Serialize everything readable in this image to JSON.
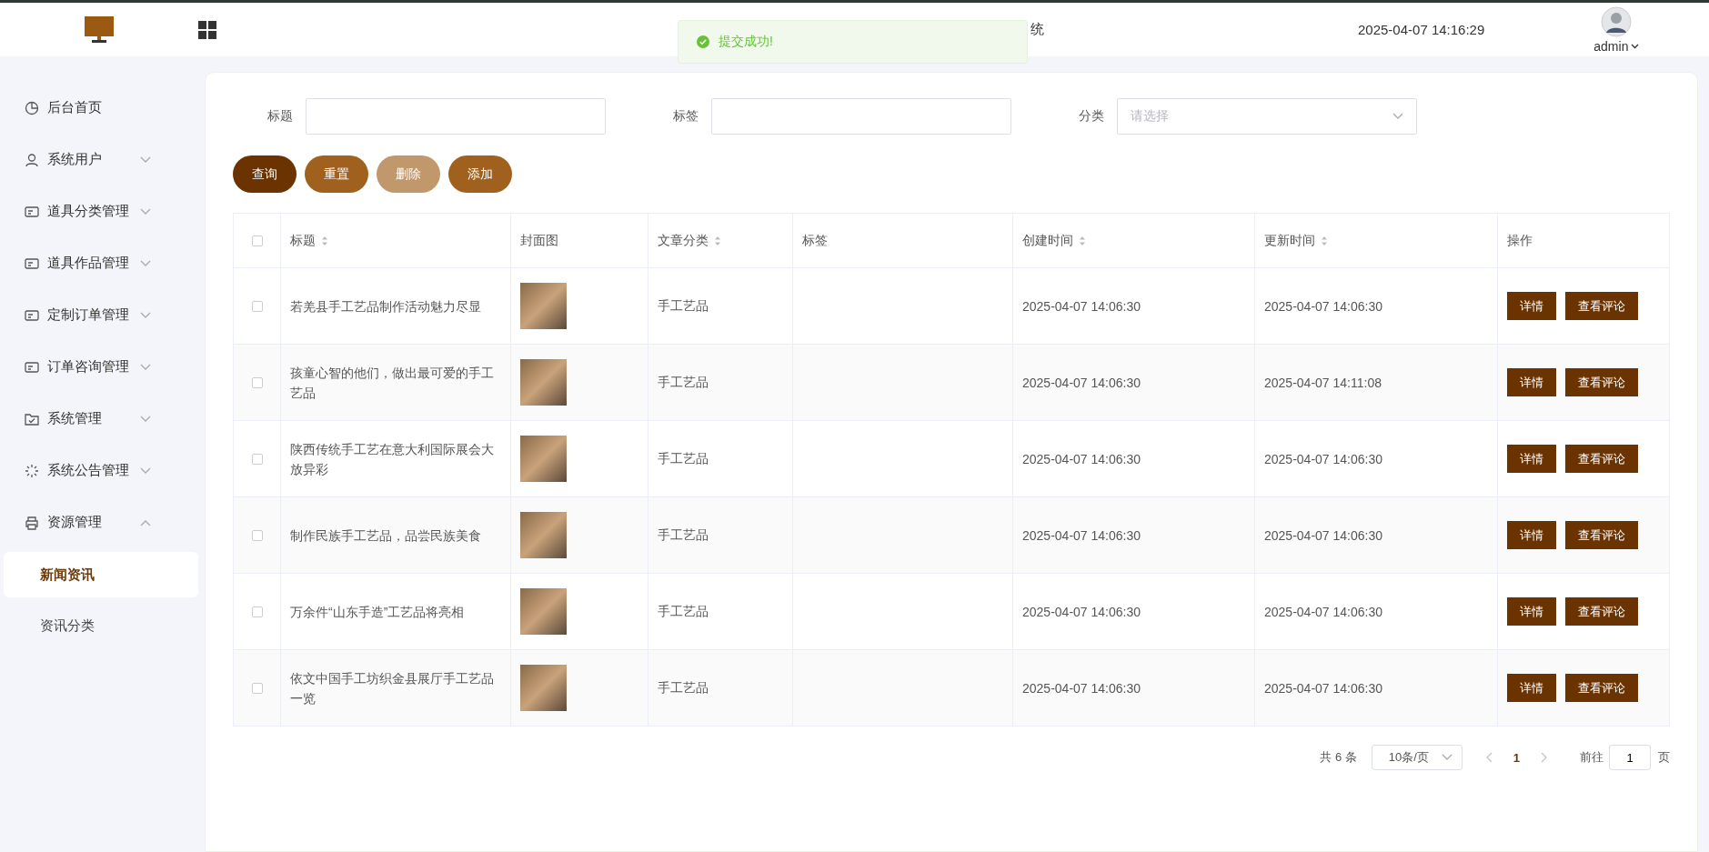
{
  "header": {
    "title": "统",
    "datetime": "2025-04-07 14:16:29",
    "user": "admin"
  },
  "toast": {
    "message": "提交成功!"
  },
  "sidebar": {
    "items": [
      {
        "label": "后台首页"
      },
      {
        "label": "系统用户",
        "expanded": false
      },
      {
        "label": "道具分类管理",
        "expanded": false
      },
      {
        "label": "道具作品管理",
        "expanded": false
      },
      {
        "label": "定制订单管理",
        "expanded": false
      },
      {
        "label": "订单咨询管理",
        "expanded": false
      },
      {
        "label": "系统管理",
        "expanded": false
      },
      {
        "label": "系统公告管理",
        "expanded": false
      },
      {
        "label": "资源管理",
        "expanded": true,
        "children": [
          {
            "label": "新闻资讯",
            "selected": true
          },
          {
            "label": "资讯分类",
            "selected": false
          }
        ]
      }
    ]
  },
  "filters": [
    {
      "label": "标题",
      "kind": "text"
    },
    {
      "label": "标签",
      "kind": "text"
    },
    {
      "label": "分类",
      "kind": "select",
      "placeholder": "请选择"
    }
  ],
  "buttons": [
    {
      "label": "查询",
      "kind": "primary",
      "disabled": false
    },
    {
      "label": "重置",
      "kind": "secondary",
      "disabled": false
    },
    {
      "label": "删除",
      "kind": "secondary",
      "disabled": true
    },
    {
      "label": "添加",
      "kind": "secondary",
      "disabled": false
    }
  ],
  "table": {
    "header_checked": false,
    "columns": [
      {
        "label": "标题",
        "sortable": true
      },
      {
        "label": "封面图",
        "sortable": false
      },
      {
        "label": "文章分类",
        "sortable": true
      },
      {
        "label": "标签",
        "sortable": false
      },
      {
        "label": "创建时间",
        "sortable": true
      },
      {
        "label": "更新时间",
        "sortable": true
      },
      {
        "label": "操作",
        "sortable": false
      }
    ],
    "rows": [
      {
        "checked": false,
        "title": "若羌县手工艺品制作活动魅力尽显",
        "category": "手工艺品",
        "created": "2025-04-07 14:06:30",
        "updated": "2025-04-07 14:06:30",
        "actions": [
          "详情",
          "查看评论"
        ]
      },
      {
        "checked": false,
        "title": "孩童心智的他们，做出最可爱的手工艺品",
        "category": "手工艺品",
        "created": "2025-04-07 14:06:30",
        "updated": "2025-04-07 14:11:08",
        "actions": [
          "详情",
          "查看评论"
        ]
      },
      {
        "checked": false,
        "title": "陕西传统手工艺在意大利国际展会大放异彩",
        "category": "手工艺品",
        "created": "2025-04-07 14:06:30",
        "updated": "2025-04-07 14:06:30",
        "actions": [
          "详情",
          "查看评论"
        ]
      },
      {
        "checked": false,
        "title": "制作民族手工艺品，品尝民族美食",
        "category": "手工艺品",
        "created": "2025-04-07 14:06:30",
        "updated": "2025-04-07 14:06:30",
        "actions": [
          "详情",
          "查看评论"
        ]
      },
      {
        "checked": false,
        "title": "万余件“山东手造”工艺品将亮相",
        "category": "手工艺品",
        "created": "2025-04-07 14:06:30",
        "updated": "2025-04-07 14:06:30",
        "actions": [
          "详情",
          "查看评论"
        ]
      },
      {
        "checked": false,
        "title": "依文中国手工坊织金县展厅手工艺品一览",
        "category": "手工艺品",
        "created": "2025-04-07 14:06:30",
        "updated": "2025-04-07 14:06:30",
        "actions": [
          "详情",
          "查看评论"
        ]
      }
    ]
  },
  "pagination": {
    "total": "共 6 条",
    "page_size": "10条/页",
    "pages": [
      {
        "label": "1",
        "selected": true
      }
    ],
    "goto_label": "前往",
    "goto_value": "1",
    "goto_suffix": "页"
  }
}
